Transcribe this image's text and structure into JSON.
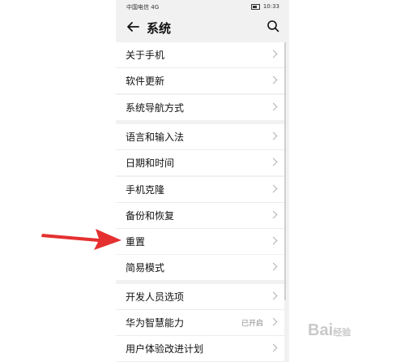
{
  "status": {
    "carrier": "中国电信",
    "signal_text": "4G",
    "time": "10:33"
  },
  "header": {
    "title": "系统"
  },
  "groups": [
    [
      {
        "label": "关于手机"
      },
      {
        "label": "软件更新"
      }
    ],
    [
      {
        "label": "系统导航方式"
      }
    ],
    [
      {
        "label": "语言和输入法"
      },
      {
        "label": "日期和时间"
      }
    ],
    [
      {
        "label": "手机克隆"
      },
      {
        "label": "备份和恢复"
      },
      {
        "label": "重置"
      }
    ],
    [
      {
        "label": "简易模式"
      }
    ],
    [
      {
        "label": "开发人员选项"
      },
      {
        "label": "华为智慧能力",
        "value": "已开启"
      },
      {
        "label": "用户体验改进计划"
      }
    ]
  ],
  "icons": {
    "back": "back-arrow-icon",
    "search": "search-icon",
    "pointer": "red-arrow-annotation"
  },
  "colors": {
    "annotation_arrow": "#e53030",
    "background": "#f1f1f1"
  },
  "watermark": {
    "text": "Bai",
    "sub": "经验"
  }
}
